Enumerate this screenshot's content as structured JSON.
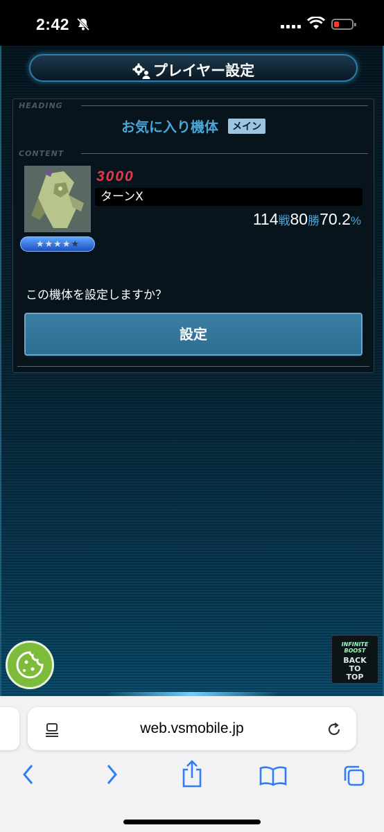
{
  "status": {
    "time": "2:42"
  },
  "header": {
    "title": "プレイヤー設定"
  },
  "panel": {
    "heading_label": "HEADING",
    "content_label": "CONTENT",
    "fav_title": "お気に入り機体",
    "badge": "メイン",
    "unit": {
      "cost": "3000",
      "name": "ターンX",
      "battles": "114",
      "battles_unit": "戦",
      "wins": "80",
      "wins_unit": "勝",
      "rate": "70.2",
      "rate_unit": "%",
      "stars_filled": 4,
      "stars_total": 5
    },
    "question": "この機体を設定しますか？",
    "set_button": "設定"
  },
  "back_to_top": {
    "logo": "INFINITE BOOST",
    "label_lines": [
      "BACK",
      "TO",
      "TOP"
    ]
  },
  "browser": {
    "url": "web.vsmobile.jp"
  },
  "colors": {
    "accent": "#4aa6d8",
    "cost": "#e23a4a",
    "button": "#3576a0",
    "cookie": "#7dbb3a",
    "ios_blue": "#2f7cf6"
  }
}
